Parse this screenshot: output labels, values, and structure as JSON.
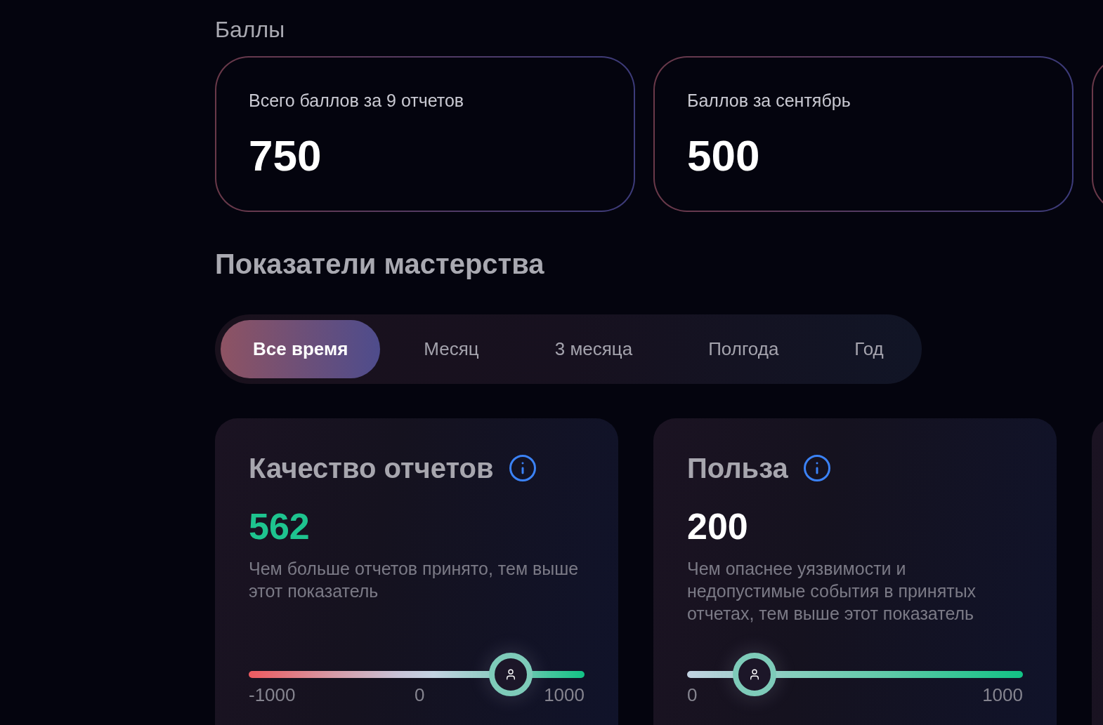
{
  "points": {
    "title": "Баллы",
    "cards": [
      {
        "label": "Всего баллов за 9 отчетов",
        "value": "750"
      },
      {
        "label": "Баллов за сентябрь",
        "value": "500"
      }
    ]
  },
  "mastery": {
    "title": "Показатели мастерства",
    "tabs": [
      {
        "label": "Все время",
        "selected": true
      },
      {
        "label": "Месяц",
        "selected": false
      },
      {
        "label": "3 месяца",
        "selected": false
      },
      {
        "label": "Полгода",
        "selected": false
      },
      {
        "label": "Год",
        "selected": false
      }
    ],
    "metrics": [
      {
        "title": "Качество отчетов",
        "value": "562",
        "color": "#1ec48f",
        "description": "Чем больше отчетов принято, тем выше этот показатель",
        "kind": "signed",
        "level": 0.781,
        "scale": [
          "-1000",
          "0",
          "1000"
        ]
      },
      {
        "title": "Польза",
        "value": "200",
        "color": "#ffffff",
        "description": "Чем опаснее уязвимости и недопустимые события в принятых отчетах, тем выше этот показатель",
        "kind": "positive",
        "level": 0.2,
        "scale": [
          "0",
          "1000"
        ]
      }
    ]
  }
}
